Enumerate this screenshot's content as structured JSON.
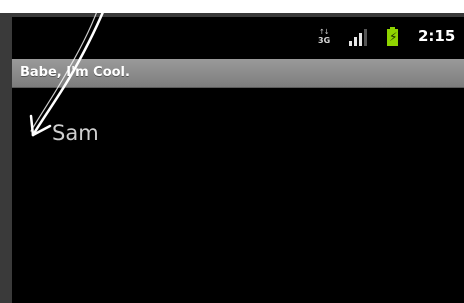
{
  "status_bar": {
    "network_type": "3G",
    "network_arrows": "↑↓",
    "signal_icon": "signal-strength-icon",
    "battery_icon": "battery-charging-icon",
    "battery_color": "#8fd400",
    "time": "2:15"
  },
  "title_bar": {
    "title": "Babe, I'm Cool."
  },
  "list": {
    "items": [
      {
        "label": "Sam"
      }
    ]
  },
  "annotation": {
    "icon": "hand-drawn-arrow-icon",
    "color": "#ffffff"
  }
}
